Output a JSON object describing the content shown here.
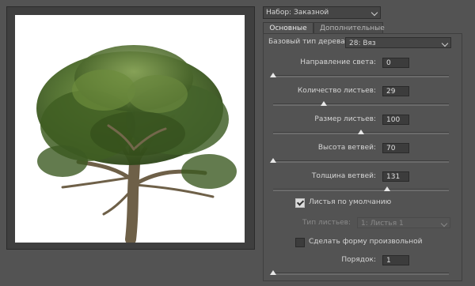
{
  "preset": {
    "label": "Набор:",
    "value": "Заказной"
  },
  "tabs": [
    {
      "label": "Основные",
      "active": true
    },
    {
      "label": "Дополнительные",
      "active": false
    }
  ],
  "base_tree": {
    "label": "Базовый тип дерева:",
    "value": "28: Вяз"
  },
  "sliders": [
    {
      "label": "Направление света:",
      "value": "0",
      "position": 0.0
    },
    {
      "label": "Количество листьев:",
      "value": "29",
      "position": 0.29
    },
    {
      "label": "Размер листьев:",
      "value": "100",
      "position": 0.5
    },
    {
      "label": "Высота ветвей:",
      "value": "70",
      "position": 0.0
    },
    {
      "label": "Толщина ветвей:",
      "value": "131",
      "position": 0.65
    }
  ],
  "leaves_default": {
    "label": "Листья по умолчанию",
    "checked": true
  },
  "leaf_type": {
    "label": "Тип листьев:",
    "value": "1: Листья 1",
    "disabled": true
  },
  "custom_shape": {
    "label": "Сделать форму произвольной",
    "checked": false
  },
  "order": {
    "label": "Порядок:",
    "value": "1",
    "position": 0.0
  },
  "colors": {
    "background": "#535353",
    "field": "#3c3c3c",
    "canvas": "#ffffff",
    "foliage": "#4a6b2a",
    "trunk": "#6e6048"
  }
}
